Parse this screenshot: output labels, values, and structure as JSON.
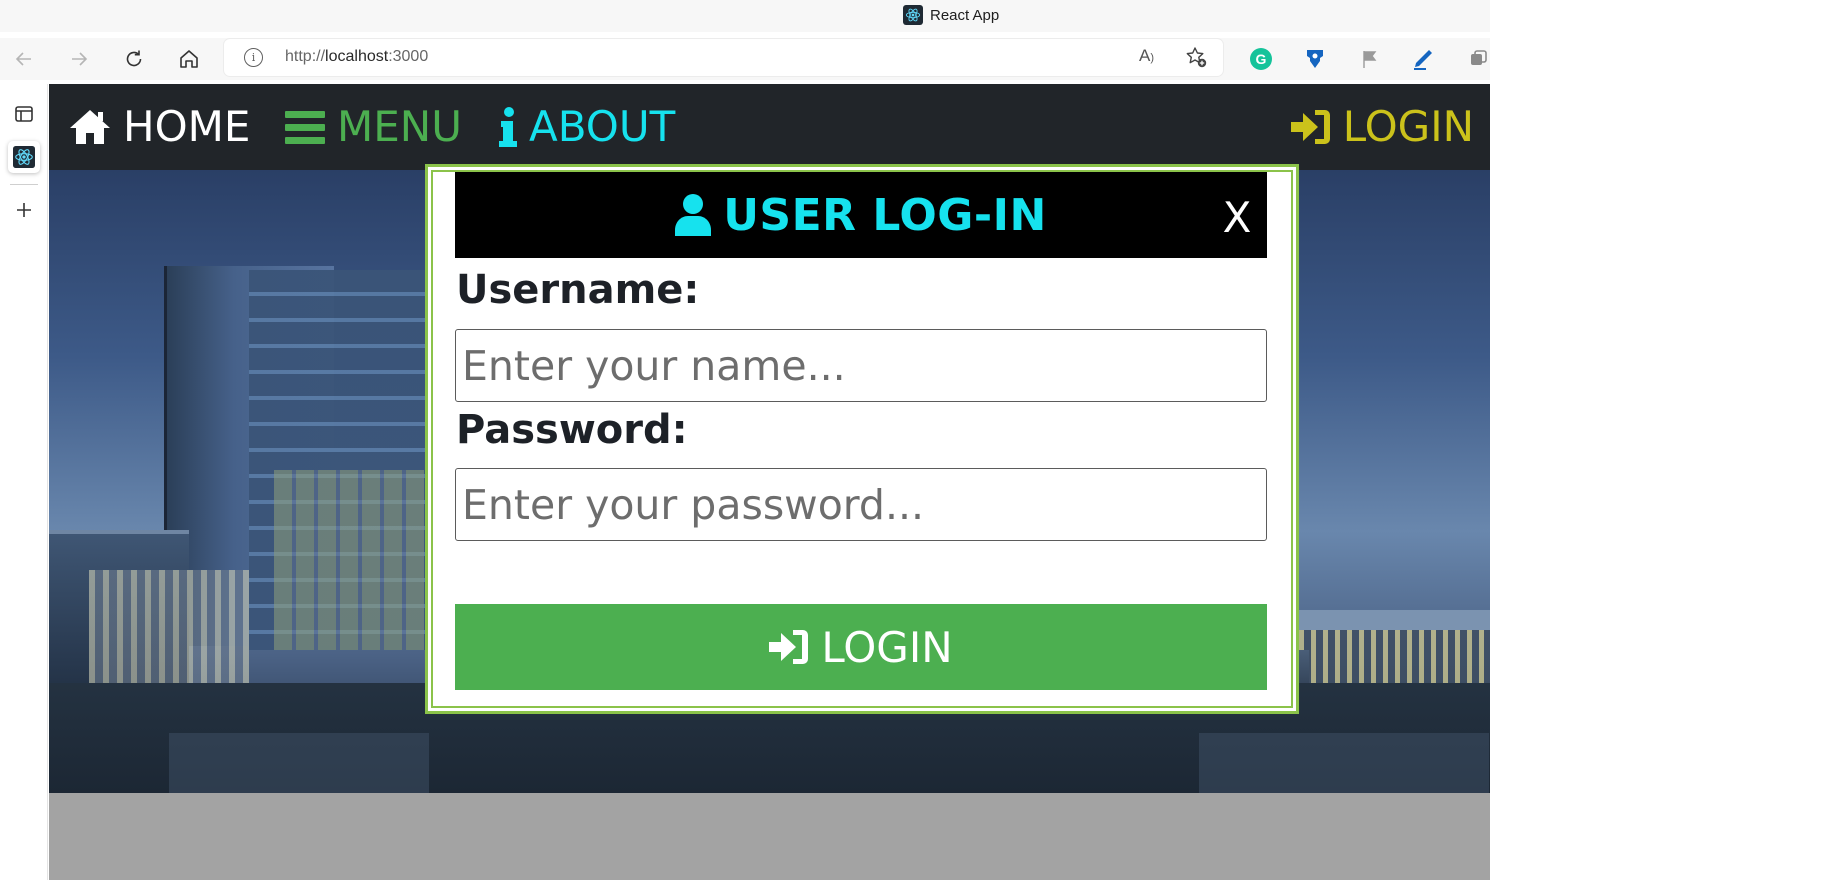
{
  "browser": {
    "tab_title": "React App",
    "url_scheme": "http://",
    "url_host": "localhost",
    "url_port": ":3000",
    "read_aloud_glyph": "A",
    "icons": [
      "back-icon",
      "forward-icon",
      "refresh-icon",
      "home-icon",
      "site-info-icon",
      "read-aloud-icon",
      "add-favorite-icon",
      "grammarly-extension-icon",
      "extension-icon",
      "flag-extension-icon",
      "pen-extension-icon",
      "collections-icon"
    ]
  },
  "colors": {
    "navbar_bg": "#212529",
    "home": "#ffffff",
    "menu": "#4caf50",
    "about": "#16e2ee",
    "login": "#cbc21b",
    "modal_border": "#8bc34a",
    "login_button": "#4caf50"
  },
  "navbar": {
    "home_label": "HOME",
    "menu_label": "MENU",
    "about_label": "ABOUT",
    "login_label": "LOGIN"
  },
  "modal": {
    "title": "USER LOG-IN",
    "close_label": "X",
    "username_label": "Username:",
    "username_placeholder": "Enter your name...",
    "password_label": "Password:",
    "password_placeholder": "Enter your password...",
    "submit_label": "LOGIN"
  }
}
